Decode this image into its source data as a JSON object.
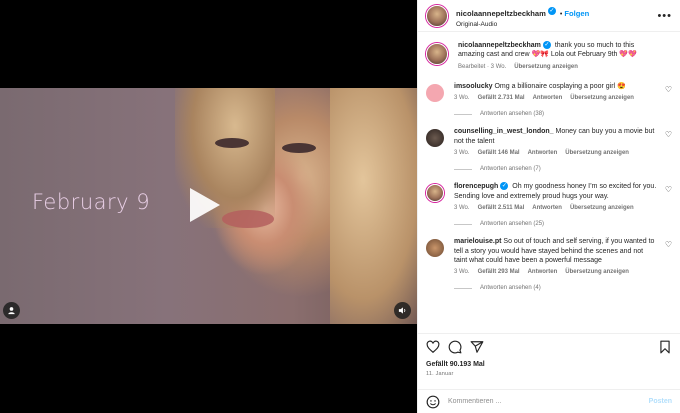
{
  "post": {
    "username": "nicolaannepeltzbeckham",
    "follow_label": "Folgen",
    "audio_label": "Original-Audio",
    "caption_text": "thank you so much to this amazing cast and crew 💖🎀 Lola out February 9th 💖💖",
    "caption_meta": "Bearbeitet · 3 Wo.",
    "caption_translate": "Übersetzung anzeigen"
  },
  "video": {
    "overlay_text": "February 9"
  },
  "comments": [
    {
      "username": "imsoolucky",
      "text": "Omg a billionaire cosplaying a poor girl 😍",
      "age": "3 Wo.",
      "likes": "Gefällt 2.731 Mal",
      "reply": "Antworten",
      "translate": "Übersetzung anzeigen",
      "replies": "Antworten ansehen (38)"
    },
    {
      "username": "counselling_in_west_london_",
      "text": "Money can buy you a movie but not the talent",
      "age": "3 Wo.",
      "likes": "Gefällt 146 Mal",
      "reply": "Antworten",
      "translate": "Übersetzung anzeigen",
      "replies": "Antworten ansehen (7)"
    },
    {
      "username": "florencepugh",
      "text": "Oh my goodness honey I’m so excited for you. Sending love and extremely proud hugs your way.",
      "age": "3 Wo.",
      "likes": "Gefällt 2.511 Mal",
      "reply": "Antworten",
      "translate": "Übersetzung anzeigen",
      "replies": "Antworten ansehen (25)"
    },
    {
      "username": "marielouise.pt",
      "text": "So out of touch and self serving, if you wanted to tell a story you would have stayed behind the scenes and not taint what could have been a powerful message",
      "age": "3 Wo.",
      "likes": "Gefällt 293 Mal",
      "reply": "Antworten",
      "translate": "Übersetzung anzeigen",
      "replies": "Antworten ansehen (4)"
    }
  ],
  "actions": {
    "likes_label": "Gefällt 90.193 Mal",
    "date": "11. Januar"
  },
  "compose": {
    "placeholder": "Kommentieren ...",
    "post_label": "Posten"
  },
  "colors": {
    "accent": "#0095f6",
    "verified": "#0095f6",
    "muted": "#737373"
  }
}
